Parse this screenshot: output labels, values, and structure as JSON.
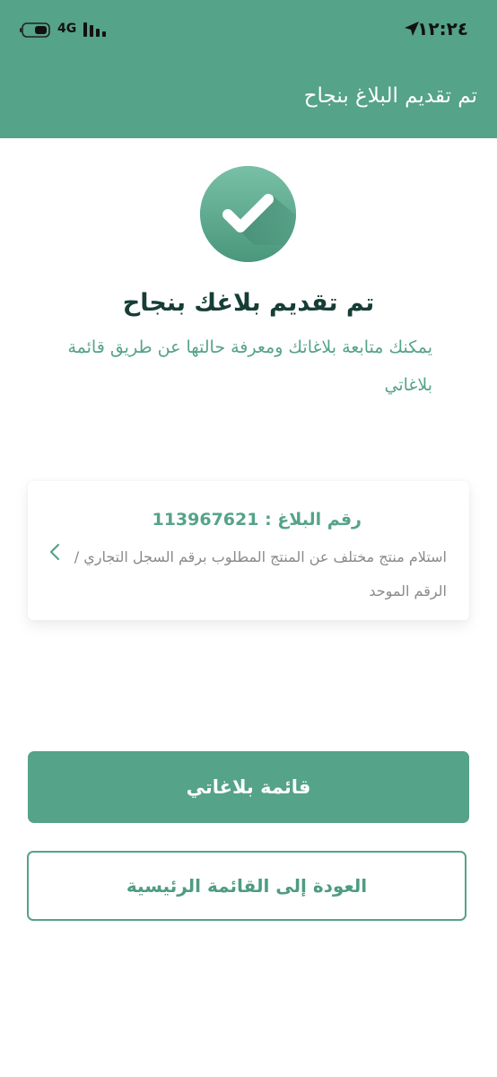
{
  "status_bar": {
    "time": "١٢:٢٤",
    "network": "4G",
    "icons": [
      "battery-icon",
      "signal-icon",
      "location-arrow-icon"
    ]
  },
  "header": {
    "title": "تم تقديم البلاغ بنجاح"
  },
  "success": {
    "icon": "check-icon",
    "title": "تم تقديم بلاغك بنجاح",
    "description": "يمكنك متابعة بلاغاتك ومعرفة حالتها عن طريق قائمة بلاغاتي"
  },
  "report_card": {
    "number_label": "رقم البلاغ : 113967621",
    "description": "استلام منتج مختلف عن المنتج المطلوب برقم السجل التجاري / الرقم الموحد",
    "chevron": "chevron-left-icon"
  },
  "buttons": {
    "my_reports": "قائمة بلاغاتي",
    "back_home": "العودة إلى القائمة الرئيسية"
  },
  "colors": {
    "primary": "#55a388",
    "dark_text": "#163d36",
    "muted_text": "#8a8a8a"
  }
}
